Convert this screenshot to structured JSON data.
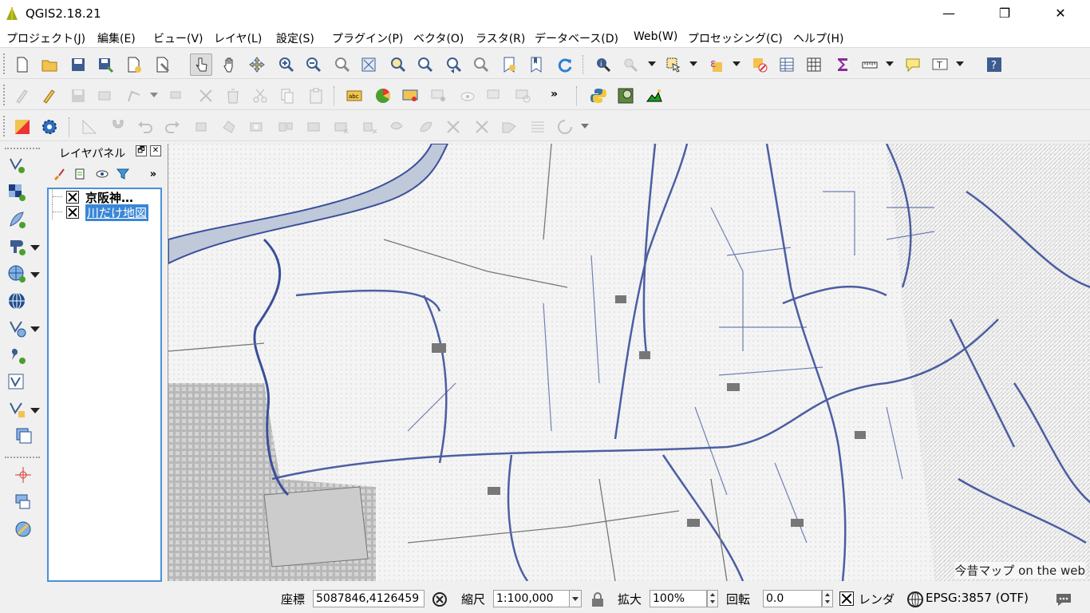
{
  "window": {
    "title": "QGIS2.18.21",
    "minimize": "—",
    "maximize": "❐",
    "close": "✕"
  },
  "menu": [
    "プロジェクト(J)",
    "編集(E)",
    "ビュー(V)",
    "レイヤ(L)",
    "設定(S)",
    "プラグイン(P)",
    "ベクタ(O)",
    "ラスタ(R)",
    "データベース(D)",
    "Web(W)",
    "プロセッシング(C)",
    "ヘルプ(H)"
  ],
  "layer_panel": {
    "title": "レイヤパネル",
    "more": "»",
    "float_glyph": "🗗",
    "close_glyph": "✕",
    "layers": [
      {
        "name": "京阪神…",
        "checked": true,
        "selected": false
      },
      {
        "name": "川だけ地図",
        "checked": true,
        "selected": true
      }
    ]
  },
  "toolbar": {
    "more_glyph": "»"
  },
  "map": {
    "attribution": "今昔マップ on the web"
  },
  "status": {
    "coord_label": "座標",
    "coord_value": "5087846,4126459",
    "scale_label": "縮尺",
    "scale_value": "1:100,000",
    "magnifier_label": "拡大",
    "magnifier_value": "100%",
    "rotation_label": "回転",
    "rotation_value": "0.0",
    "render_label": "レンダ",
    "render_checked": true,
    "crs_label": "EPSG:3857 (OTF)"
  },
  "colors": {
    "river": "#3a4f9a",
    "selection": "#3a86d6",
    "panel_border": "#4a90d9"
  }
}
